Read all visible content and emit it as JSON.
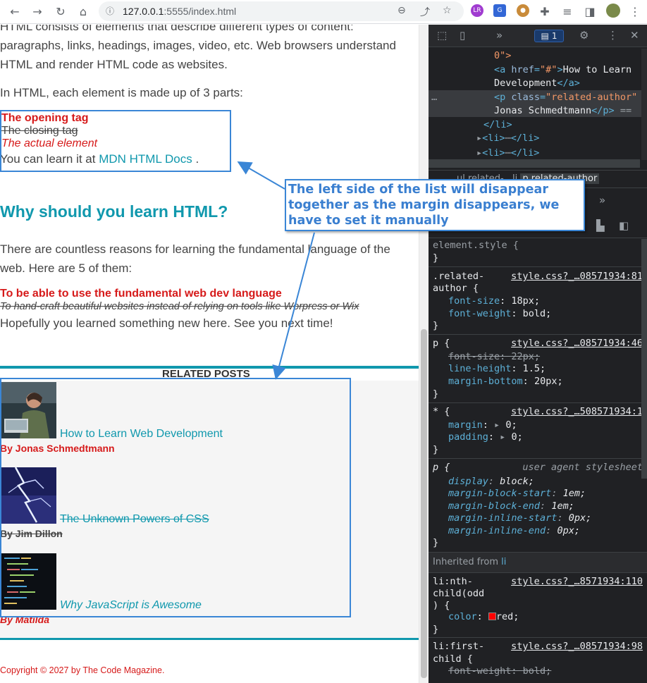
{
  "browser": {
    "url_host": "127.0.0.1",
    "url_port": ":5555",
    "url_path": "/index.html",
    "back_icon": "arrow-left-icon",
    "forward_icon": "arrow-right-icon",
    "reload_icon": "reload-icon",
    "home_icon": "home-icon"
  },
  "page": {
    "intro_line1": "HTML consists of elements that describe different types of content:",
    "intro_line2": "paragraphs, links, headings, images, video, etc. Web browsers understand",
    "intro_line3": "HTML and render HTML code as websites.",
    "parts_intro": "In HTML, each element is made up of 3 parts:",
    "list": {
      "item1": "The opening tag",
      "item2": "The closing tag",
      "item3": "The actual element"
    },
    "learn_prefix": "You can learn it at ",
    "learn_link": "MDN HTML Docs",
    "learn_suffix": " .",
    "heading": "Why should you learn HTML?",
    "reasons_line1": "There are countless reasons for learning the fundamental language of the",
    "reasons_line2": "web. Here are 5 of them:",
    "reason1": "To be able to use the fundamental web dev language",
    "reason2": "To hand-craft beautiful websites instead of relying on tools like Worpress or Wix",
    "closing": "Hopefully you learned something new here. See you next time!",
    "related_title": "RELATED POSTS",
    "posts": [
      {
        "title": "How to Learn Web Development",
        "author": "By Jonas Schmedtmann"
      },
      {
        "title": "The Unknown Powers of CSS",
        "author": "By Jim Dillon"
      },
      {
        "title": "Why JavaScript is Awesome",
        "author": "By Matilda"
      }
    ],
    "copyright": "Copyright © 2027 by The Code Magazine."
  },
  "callout": {
    "line1": "The left side of the list will disappear",
    "line2": "together as the margin disappears, we",
    "line3": "have to set it manually"
  },
  "devtools": {
    "issues_count": "1",
    "elements": {
      "l0": "0\">",
      "l1_tag_open": "<a ",
      "l1_attr": "href",
      "l1_val": "\"#\"",
      "l1_text": "How to Learn",
      "l2_text": "Development",
      "l2_close": "</a>",
      "l3_tag": "<p ",
      "l3_attr": "class",
      "l3_val": "\"related-author\"",
      "l4_text": "Jonas Schmedtmann",
      "l4_close": "</p>",
      "l4_eq": " ==",
      "l5": "</li>",
      "l6": "<li>",
      "l6_close": "</li>",
      "l7": "<li>",
      "l7_close": "</li>",
      "ellipsis": "…"
    },
    "breadcrumb": {
      "crumb1": "ul.related-...li",
      "crumb2": "p.related-author"
    },
    "styles": {
      "element_style": "element.style {",
      "close": "}",
      "rule1": {
        "selector_a": ".related-",
        "selector_b": "author {",
        "source": "style.css?_…08571934:81",
        "props": [
          {
            "name": "font-size",
            "value": "18px;"
          },
          {
            "name": "font-weight",
            "value": "bold;"
          }
        ]
      },
      "rule2": {
        "selector": "p {",
        "source": "style.css?_…08571934:46",
        "props": [
          {
            "name": "font-size",
            "value": "22px;"
          },
          {
            "name": "line-height",
            "value": "1.5;"
          },
          {
            "name": "margin-bottom",
            "value": "20px;"
          }
        ]
      },
      "rule3": {
        "selector": "* {",
        "source": "style.css?_…508571934:1",
        "props": [
          {
            "name": "margin",
            "value": "0;"
          },
          {
            "name": "padding",
            "value": "0;"
          }
        ]
      },
      "rule4": {
        "selector": "p {",
        "source": "user agent stylesheet",
        "props": [
          {
            "name": "display",
            "value": "block;"
          },
          {
            "name": "margin-block-start",
            "value": "1em;"
          },
          {
            "name": "margin-block-end",
            "value": "1em;"
          },
          {
            "name": "margin-inline-start",
            "value": "0px;"
          },
          {
            "name": "margin-inline-end",
            "value": "0px;"
          }
        ]
      },
      "inherited_label": "Inherited from ",
      "inherited_el": "li",
      "rule5": {
        "selector_a": "li:nth-",
        "selector_b": "child(odd",
        "selector_c": ") {",
        "source": "style.css?_…8571934:110",
        "props": [
          {
            "name": "color",
            "value": "red;"
          }
        ]
      },
      "rule6": {
        "selector_a": "li:first-",
        "selector_b": "child {",
        "source": "style.css?_…08571934:98",
        "props": [
          {
            "name": "font-weight",
            "value": "bold;"
          }
        ]
      }
    }
  },
  "colors": {
    "accent_teal": "#1098ad",
    "list_red": "#d61a1a",
    "annotation_blue": "#3a86d6"
  }
}
